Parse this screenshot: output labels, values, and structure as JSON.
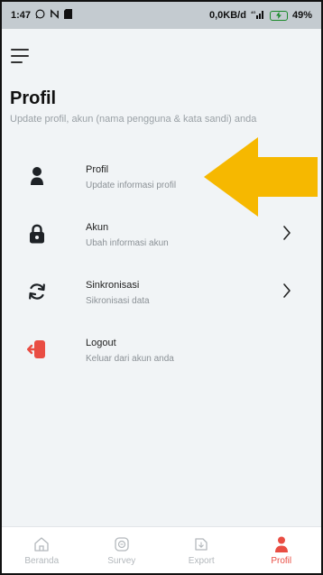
{
  "status_bar": {
    "time": "1:47",
    "network_speed": "0,0KB/d",
    "battery": "49%"
  },
  "header": {
    "menu_icon": "hamburger-icon",
    "title": "Profil",
    "subtitle": "Update profil, akun (nama pengguna & kata sandi) anda"
  },
  "menu": {
    "items": [
      {
        "id": "profil",
        "icon": "user-icon",
        "title": "Profil",
        "desc": "Update informasi profil",
        "has_chevron": false
      },
      {
        "id": "akun",
        "icon": "lock-icon",
        "title": "Akun",
        "desc": "Ubah informasi akun",
        "has_chevron": true
      },
      {
        "id": "sinkronisasi",
        "icon": "sync-icon",
        "title": "Sinkronisasi",
        "desc": "Sikronisasi data",
        "has_chevron": true
      },
      {
        "id": "logout",
        "icon": "logout-icon",
        "title": "Logout",
        "desc": "Keluar dari akun anda",
        "has_chevron": false
      }
    ]
  },
  "annotation": {
    "arrow_color": "#f6b800"
  },
  "bottom_nav": {
    "items": [
      {
        "id": "beranda",
        "label": "Beranda",
        "icon": "home-icon",
        "active": false
      },
      {
        "id": "survey",
        "label": "Survey",
        "icon": "survey-icon",
        "active": false
      },
      {
        "id": "export",
        "label": "Export",
        "icon": "export-icon",
        "active": false
      },
      {
        "id": "profil",
        "label": "Profil",
        "icon": "user-icon",
        "active": true
      }
    ]
  },
  "colors": {
    "accent": "#e94d43",
    "background": "#f1f4f6",
    "status_bar": "#c4cbd0"
  }
}
